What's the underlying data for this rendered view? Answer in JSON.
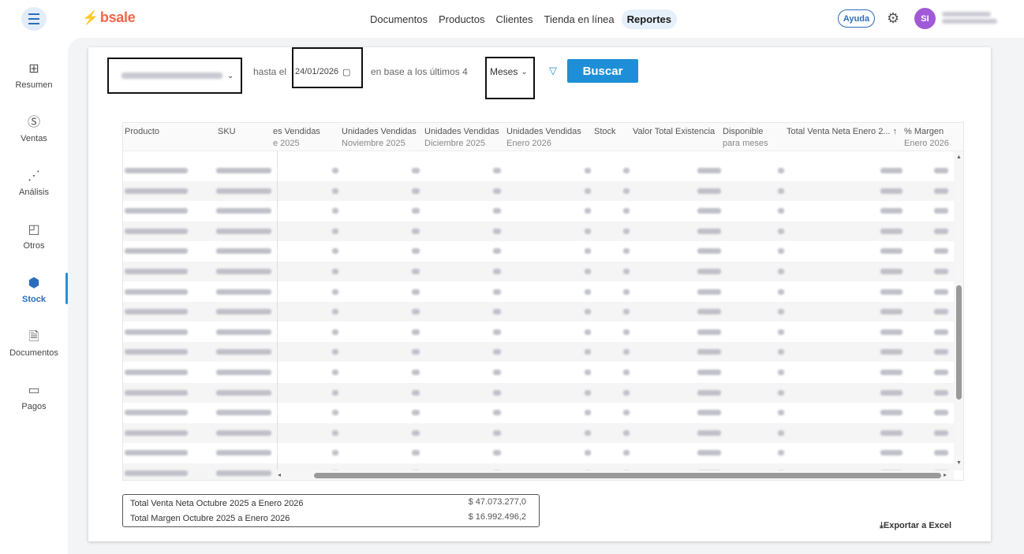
{
  "header": {
    "logo": "bsale",
    "nav": [
      {
        "label": "Documentos",
        "active": false
      },
      {
        "label": "Productos",
        "active": false
      },
      {
        "label": "Clientes",
        "active": false
      },
      {
        "label": "Tienda en línea",
        "active": false
      },
      {
        "label": "Reportes",
        "active": true
      }
    ],
    "help_label": "Ayuda",
    "avatar_initials": "SI"
  },
  "sidebar": {
    "items": [
      {
        "label": "Resumen",
        "icon": "grid-icon"
      },
      {
        "label": "Ventas",
        "icon": "dollar-icon"
      },
      {
        "label": "Análisis",
        "icon": "analysis-icon"
      },
      {
        "label": "Otros",
        "icon": "chart-icon"
      },
      {
        "label": "Stock",
        "icon": "stock-icon",
        "active": true
      },
      {
        "label": "Documentos",
        "icon": "document-icon"
      },
      {
        "label": "Pagos",
        "icon": "card-icon"
      }
    ]
  },
  "filters": {
    "until_label": "hasta el",
    "date_value": "24/01/2026",
    "based_label": "en base a los últimos 4",
    "period_value": "Meses",
    "search_button": "Buscar"
  },
  "table": {
    "columns": [
      {
        "line1": "Producto",
        "line2": ""
      },
      {
        "line1": "SKU",
        "line2": ""
      },
      {
        "line1": "es Vendidas",
        "line2": "e 2025"
      },
      {
        "line1": "Unidades Vendidas",
        "line2": "Noviembre 2025"
      },
      {
        "line1": "Unidades Vendidas",
        "line2": "Diciembre 2025"
      },
      {
        "line1": "Unidades Vendidas",
        "line2": "Enero 2026"
      },
      {
        "line1": "Stock",
        "line2": ""
      },
      {
        "line1": "Valor Total Existencia",
        "line2": ""
      },
      {
        "line1": "Disponible",
        "line2": "para meses"
      },
      {
        "line1": "Total Venta Neta Enero 2...",
        "line2": ""
      },
      {
        "line1": "% Margen",
        "line2": "Enero 2026"
      }
    ],
    "sort_indicator": "↑",
    "row_count": 16
  },
  "totals": {
    "rows": [
      {
        "label": "Total Venta Neta Octubre 2025 a Enero 2026",
        "value": "$ 47.073.277,0"
      },
      {
        "label": "Total Margen Octubre 2025 a Enero 2026",
        "value": "$ 16.992.496,2"
      }
    ]
  },
  "export_label": "Exportar a Excel"
}
